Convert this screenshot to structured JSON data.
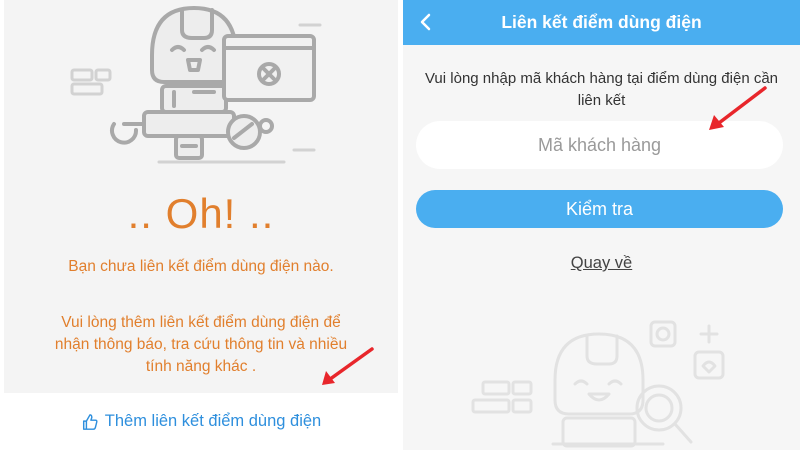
{
  "left_screen": {
    "oh_text": ".. Oh! ..",
    "message_1": "Bạn chưa liên kết điểm dùng điện nào.",
    "message_2": "Vui lòng thêm liên kết điểm dùng điện để nhận thông báo, tra cứu thông tin và nhiều tính năng khác .",
    "add_link_label": "Thêm liên kết điểm dùng điện",
    "icons": [
      "robot-illustration",
      "thumbs-up-icon"
    ]
  },
  "right_screen": {
    "header": {
      "title": "Liên kết điểm dùng điện",
      "back_icon": "chevron-left-icon"
    },
    "instruction": "Vui lòng nhập mã khách hàng tại điểm dùng điện cần liên kết",
    "customer_code": {
      "value": "",
      "placeholder": "Mã khách hàng"
    },
    "check_button": "Kiểm tra",
    "back_link": "Quay về",
    "icons": [
      "robot-illustration"
    ]
  },
  "colors": {
    "accent_blue": "#4aaef0",
    "link_blue": "#2e8fdd",
    "warning_orange": "#e17f2d",
    "annotation_red": "#e8262b"
  }
}
